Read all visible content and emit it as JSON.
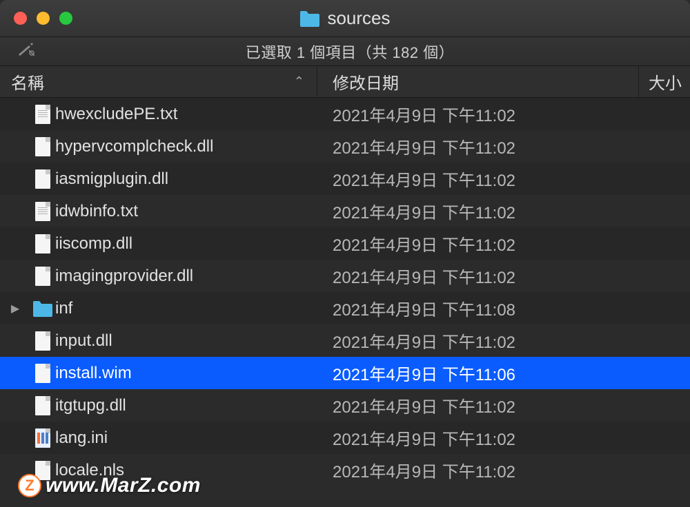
{
  "window": {
    "title": "sources"
  },
  "toolbar": {
    "status": "已選取 1 個項目（共 182 個）"
  },
  "columns": {
    "name": "名稱",
    "date": "修改日期",
    "size": "大小"
  },
  "files": [
    {
      "name": "hwexcludePE.txt",
      "date": "2021年4月9日 下午11:02",
      "type": "txt",
      "folder": false,
      "selected": false
    },
    {
      "name": "hypervcomplcheck.dll",
      "date": "2021年4月9日 下午11:02",
      "type": "file",
      "folder": false,
      "selected": false
    },
    {
      "name": "iasmigplugin.dll",
      "date": "2021年4月9日 下午11:02",
      "type": "file",
      "folder": false,
      "selected": false
    },
    {
      "name": "idwbinfo.txt",
      "date": "2021年4月9日 下午11:02",
      "type": "txt",
      "folder": false,
      "selected": false
    },
    {
      "name": "iiscomp.dll",
      "date": "2021年4月9日 下午11:02",
      "type": "file",
      "folder": false,
      "selected": false
    },
    {
      "name": "imagingprovider.dll",
      "date": "2021年4月9日 下午11:02",
      "type": "file",
      "folder": false,
      "selected": false
    },
    {
      "name": "inf",
      "date": "2021年4月9日 下午11:08",
      "type": "folder",
      "folder": true,
      "selected": false
    },
    {
      "name": "input.dll",
      "date": "2021年4月9日 下午11:02",
      "type": "file",
      "folder": false,
      "selected": false
    },
    {
      "name": "install.wim",
      "date": "2021年4月9日 下午11:06",
      "type": "file",
      "folder": false,
      "selected": true
    },
    {
      "name": "itgtupg.dll",
      "date": "2021年4月9日 下午11:02",
      "type": "file",
      "folder": false,
      "selected": false
    },
    {
      "name": "lang.ini",
      "date": "2021年4月9日 下午11:02",
      "type": "ini",
      "folder": false,
      "selected": false
    },
    {
      "name": "locale.nls",
      "date": "2021年4月9日 下午11:02",
      "type": "file",
      "folder": false,
      "selected": false
    }
  ],
  "watermark": {
    "badge": "Z",
    "text": "www.MarZ.com"
  }
}
